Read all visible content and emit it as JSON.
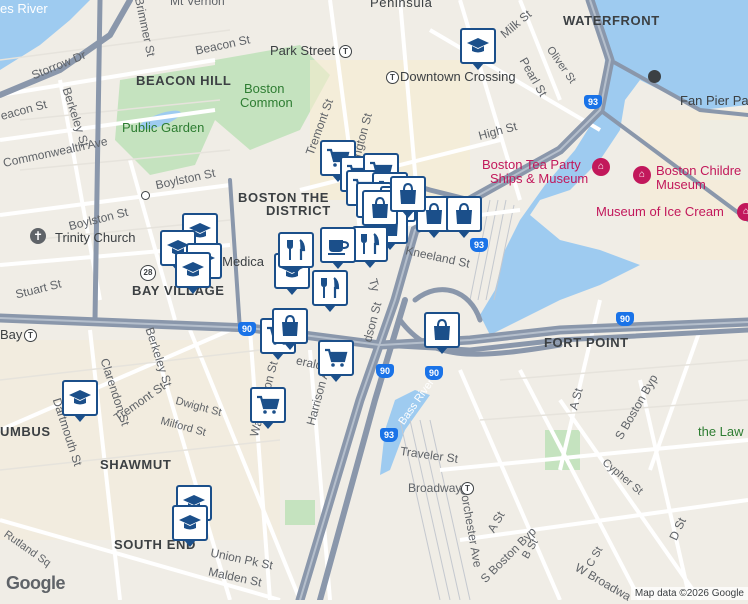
{
  "colors": {
    "water": "#9ecbf0",
    "land": "#f0ede6",
    "park": "#c5e3bf",
    "highway": "#8a97ab",
    "road": "#ffffff",
    "marker_border": "#1b4f8a",
    "poi_pink": "#c2185b",
    "poi_green": "#2e7d32"
  },
  "labels": {
    "peninsula": "Peninsula",
    "waterfront": "WATERFRONT",
    "beacon_hill": "BEACON HILL",
    "boston_theater_1": "BOSTON THE",
    "boston_theater_2": "DISTRICT",
    "bay_village": "BAY VILLAGE",
    "shawmut": "SHAWMUT",
    "south_end": "SOUTH END",
    "fort_point": "FORT POINT",
    "columbus": "UMBUS",
    "charles_river": "es River",
    "bass_river": "Bass River"
  },
  "streets": {
    "beacon_st": "Beacon St",
    "storrow": "Storrow Dr",
    "boylston_1": "Boylston St",
    "boylston_2": "Boylston St",
    "stuart": "Stuart St",
    "commonwealth": "Commonwealth Ave",
    "beacon_st_w": "eacon St",
    "berkeley": "Berkeley St",
    "berkeley_2": "Berkeley St",
    "brimmer": "Brimmer St",
    "tremont": "Tremont St",
    "tremont_2": "Tremont St",
    "kneeland": "Kneeland St",
    "high_st": "High St",
    "milk_st": "Milk St",
    "pearl_st": "Pearl St",
    "oliver_st": "Oliver St",
    "clarendon": "Clarendon St",
    "dartmouth": "Dartmouth St",
    "dwight": "Dwight St",
    "milford": "Milford St",
    "herald": "erald",
    "harrison": "Harrison Ave",
    "washington": "Washington St",
    "traveler": "Traveler St",
    "broadway": "Broadway",
    "dorchester": "Dorchester Ave",
    "union_pk": "Union Pk St",
    "malden": "Malden St",
    "rutland": "Rutland Sq",
    "a_st": "A St",
    "a_st_2": "A St",
    "s_boston_byp": "S Boston Byp",
    "s_boston_byp_2": "S Boston Byp",
    "b_st": "B St",
    "c_st": "C St",
    "d_st": "D St",
    "cypher": "Cypher St",
    "w_broadway": "W Broadwa",
    "mt_vernon": "Mt Vernon",
    "hudson": "dson St",
    "tyler": "Ty",
    "washington_n": "ngton St"
  },
  "pois": {
    "park_street": "Park Street",
    "downtown_crossing": "Downtown Crossing",
    "boston_common_1": "Boston",
    "boston_common_2": "Common",
    "public_garden": "Public Garden",
    "trinity_church": "Trinity Church",
    "tea_party_1": "Boston Tea Party",
    "tea_party_2": "Ships & Museum",
    "childrens_1": "Boston Childre",
    "childrens_2": "Museum",
    "ice_cream": "Museum of Ice Cream",
    "fan_pier": "Fan Pier Pa",
    "medical": "s Medica",
    "the_law": "the Law",
    "back_bay": "Bay"
  },
  "highways": {
    "i90_a": "90",
    "i90_b": "90",
    "i90_c": "90",
    "i90_d": "90",
    "i93_a": "93",
    "i93_b": "93",
    "i93_c": "93",
    "i93_d": "90",
    "rt28": "28"
  },
  "footer": {
    "logo": "Google",
    "attribution": "Map data ©2026 Google"
  },
  "markers": [
    {
      "type": "education",
      "name": "school-marker"
    },
    {
      "type": "grocery",
      "name": "grocery-marker"
    },
    {
      "type": "shopping",
      "name": "shopping-marker"
    },
    {
      "type": "restaurant",
      "name": "restaurant-marker"
    },
    {
      "type": "cafe",
      "name": "cafe-marker"
    }
  ]
}
